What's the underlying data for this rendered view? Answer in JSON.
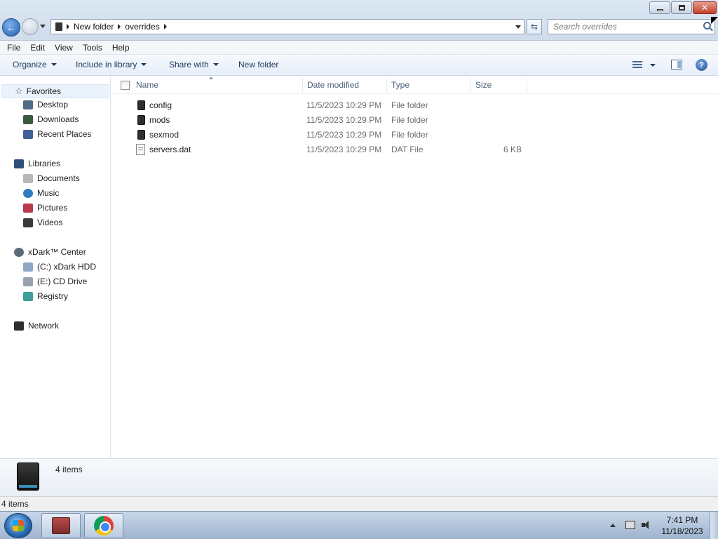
{
  "search": {
    "placeholder": "Search overrides"
  },
  "address": {
    "crumbs": [
      "New folder",
      "overrides"
    ]
  },
  "menu": [
    "File",
    "Edit",
    "View",
    "Tools",
    "Help"
  ],
  "toolbar": {
    "organize": "Organize",
    "include": "Include in library",
    "share": "Share with",
    "new_folder": "New folder"
  },
  "nav": {
    "favorites": {
      "label": "Favorites",
      "items": [
        "Desktop",
        "Downloads",
        "Recent Places"
      ]
    },
    "libraries": {
      "label": "Libraries",
      "items": [
        "Documents",
        "Music",
        "Pictures",
        "Videos"
      ]
    },
    "computer": {
      "label": "xDark™ Center",
      "items": [
        "(C:) xDark HDD",
        "(E:) CD Drive",
        "Registry"
      ]
    },
    "network": {
      "label": "Network"
    }
  },
  "columns": {
    "name": "Name",
    "date": "Date modified",
    "type": "Type",
    "size": "Size"
  },
  "files": [
    {
      "name": "config",
      "date": "11/5/2023 10:29 PM",
      "type": "File folder",
      "size": "",
      "icon": "folder-icon"
    },
    {
      "name": "mods",
      "date": "11/5/2023 10:29 PM",
      "type": "File folder",
      "size": "",
      "icon": "folder-icon"
    },
    {
      "name": "sexmod",
      "date": "11/5/2023 10:29 PM",
      "type": "File folder",
      "size": "",
      "icon": "folder-icon"
    },
    {
      "name": "servers.dat",
      "date": "11/5/2023 10:29 PM",
      "type": "DAT File",
      "size": "6 KB",
      "icon": "document-icon"
    }
  ],
  "details": {
    "count": "4 items"
  },
  "status": {
    "count": "4 items"
  },
  "clock": {
    "time": "7:41 PM",
    "date": "11/18/2023"
  }
}
